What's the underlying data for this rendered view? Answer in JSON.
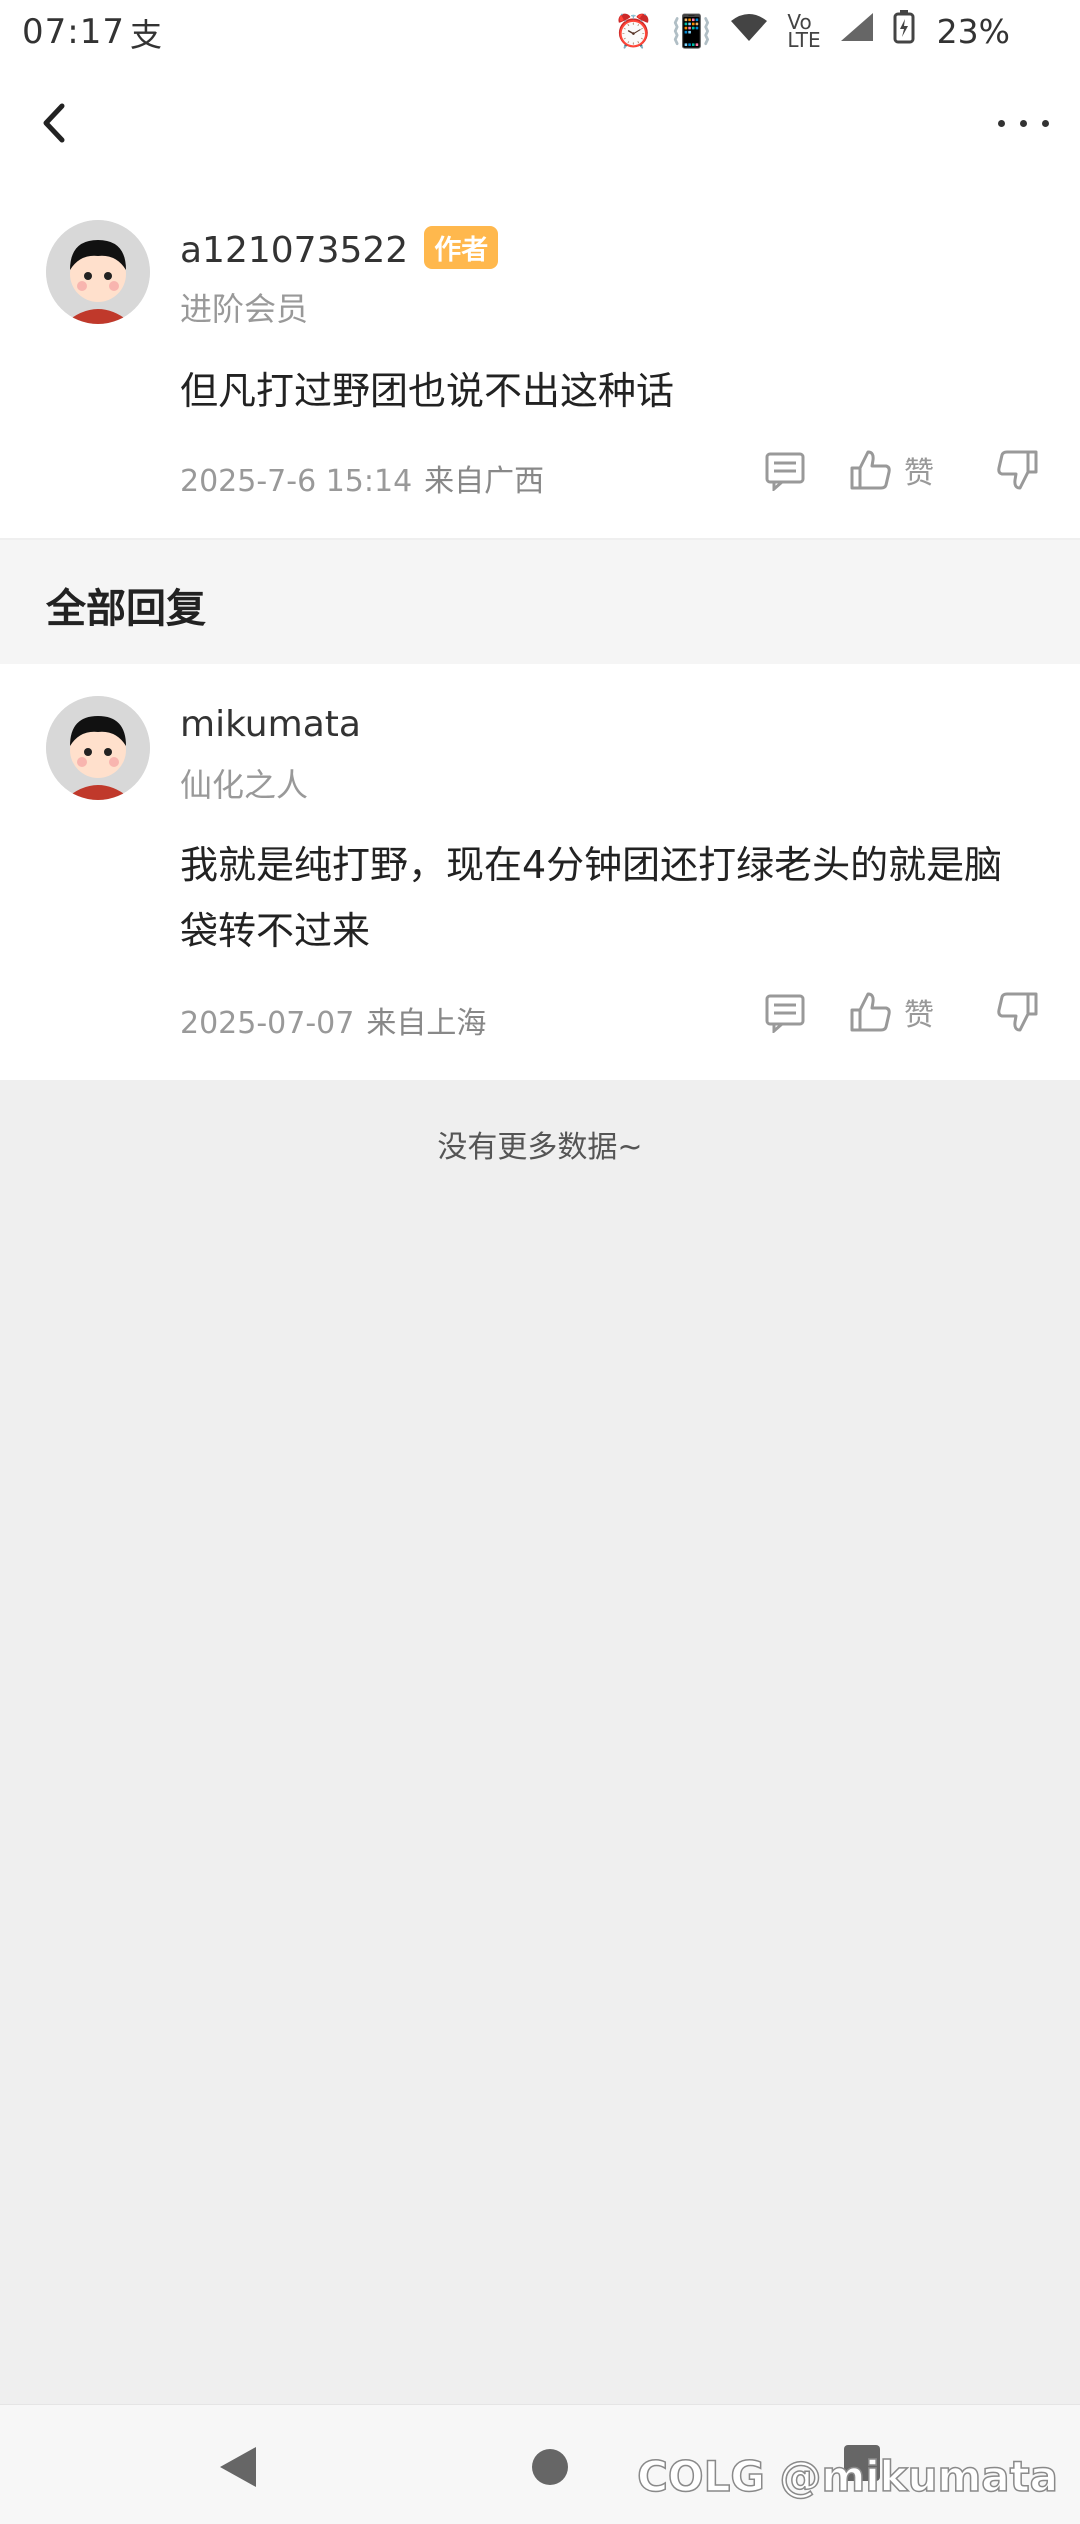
{
  "status_bar": {
    "time": "07:17",
    "alipay_glyph": "支",
    "battery": "23%"
  },
  "post": {
    "username": "a121073522",
    "badge": "作者",
    "level": "进阶会员",
    "content": "但凡打过野团也说不出这种话",
    "date": "2025-7-6 15:14",
    "location": "来自广西",
    "like_label": "赞"
  },
  "section": {
    "title": "全部回复"
  },
  "reply": {
    "username": "mikumata",
    "level": "仙化之人",
    "content": "我就是纯打野，现在4分钟团还打绿老头的就是脑袋转不过来",
    "date": "2025-07-07",
    "location": "来自上海",
    "like_label": "赞"
  },
  "footer": {
    "no_more": "没有更多数据~"
  },
  "watermark": "COLG @mikumata"
}
